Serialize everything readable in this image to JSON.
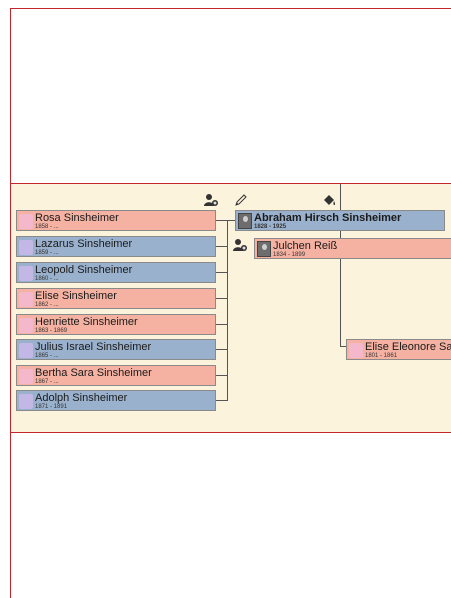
{
  "colors": {
    "frame_red": "#c0262c",
    "band_bg": "#fcf3dd",
    "female_card": "#f5b2a2",
    "male_card": "#9ab1cd",
    "female_avatar": "#f4b8cc",
    "male_avatar": "#c3b7e6"
  },
  "toolbar": {
    "add_person_icon": "add-person-icon",
    "edit_icon": "pencil-icon",
    "fill_icon": "paint-bucket-icon"
  },
  "main_person": {
    "name": "Abraham Hirsch Sinsheimer",
    "dates": "1828 - 1925",
    "gender": "male"
  },
  "spouse": {
    "name": "Julchen Reiß",
    "dates": "1834 - 1899",
    "gender": "female"
  },
  "mother": {
    "name": "Elise Eleonore Sau",
    "dates": "1801 - 1861",
    "gender": "female"
  },
  "children": [
    {
      "name": "Rosa Sinsheimer",
      "dates": "1858 - ...",
      "gender": "female"
    },
    {
      "name": "Lazarus Sinsheimer",
      "dates": "1859 - ...",
      "gender": "male"
    },
    {
      "name": "Leopold Sinsheimer",
      "dates": "1860 - ...",
      "gender": "male"
    },
    {
      "name": "Elise Sinsheimer",
      "dates": "1862 - ...",
      "gender": "female"
    },
    {
      "name": "Henriette Sinsheimer",
      "dates": "1863 - 1869",
      "gender": "female"
    },
    {
      "name": "Julius Israel Sinsheimer",
      "dates": "1865 - ...",
      "gender": "male"
    },
    {
      "name": "Bertha Sara Sinsheimer",
      "dates": "1867 - ...",
      "gender": "female"
    },
    {
      "name": "Adolph Sinsheimer",
      "dates": "1871 - 1891",
      "gender": "male"
    }
  ]
}
